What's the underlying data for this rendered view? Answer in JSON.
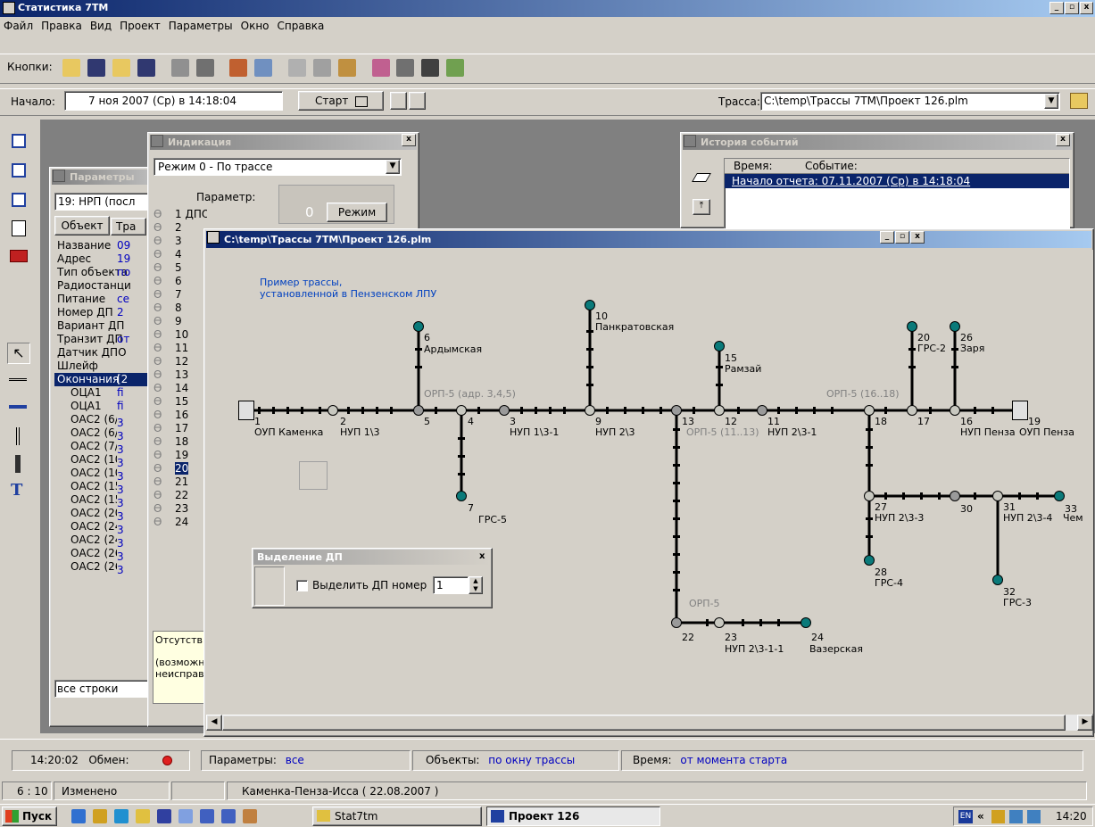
{
  "app": {
    "title": "Статистика 7ТМ"
  },
  "menu": [
    "Файл",
    "Правка",
    "Вид",
    "Проект",
    "Параметры",
    "Окно",
    "Справка"
  ],
  "toolbar": {
    "label": "Кнопки:"
  },
  "controls": {
    "start_label": "Начало:",
    "start_value": "7 ноя 2007 (Ср)  в  14:18:04",
    "start_button": "Старт",
    "trace_label": "Трасса:",
    "trace_value": "C:\\temp\\Трассы 7ТМ\\Проект 126.plm"
  },
  "params_window": {
    "title": "Параметры",
    "selector": "19: НРП    (посл",
    "tabs": [
      "Объект",
      "Тра"
    ],
    "rows": [
      {
        "name": "Название",
        "val": "09"
      },
      {
        "name": "Адрес",
        "val": "19"
      },
      {
        "name": "Тип объекта",
        "val": "по"
      },
      {
        "name": "Радиостанци",
        "val": ""
      },
      {
        "name": "Питание",
        "val": "се"
      },
      {
        "name": "Номер ДП",
        "val": "2"
      },
      {
        "name": "Вариант ДП",
        "val": ""
      },
      {
        "name": "Транзит ДП",
        "val": "от"
      },
      {
        "name": "Датчик ДПО",
        "val": ""
      },
      {
        "name": "Шлейф",
        "val": ""
      },
      {
        "name": "Окончания",
        "val": "[2"
      },
      {
        "name": "ОЦА1",
        "val": "fi"
      },
      {
        "name": "ОЦА1",
        "val": "fi"
      },
      {
        "name": "ОАС2 (6/3",
        "val": "3"
      },
      {
        "name": "ОАС2 (6/4",
        "val": "3"
      },
      {
        "name": "ОАС2 (7/3",
        "val": "3"
      },
      {
        "name": "ОАС2 (10/",
        "val": "3"
      },
      {
        "name": "ОАС2 (10/",
        "val": "3"
      },
      {
        "name": "ОАС2 (15/",
        "val": "3"
      },
      {
        "name": "ОАС2 (15/",
        "val": "3"
      },
      {
        "name": "ОАС2 (20/",
        "val": "3"
      },
      {
        "name": "ОАС2 (24/",
        "val": "3"
      },
      {
        "name": "ОАС2 (24/",
        "val": "3"
      },
      {
        "name": "ОАС2 (26/",
        "val": "3"
      },
      {
        "name": "ОАС2 (26/",
        "val": "3"
      }
    ],
    "footer": "все строки"
  },
  "indication_window": {
    "title": "Индикация",
    "mode": "Режим 0 -  По трассе",
    "param_header": "Параметр:",
    "first_param": "ДПО",
    "value": "0",
    "mode_button": "Режим",
    "numbers": [
      "1",
      "2",
      "3",
      "4",
      "5",
      "6",
      "7",
      "8",
      "9",
      "10",
      "11",
      "12",
      "13",
      "14",
      "15",
      "16",
      "17",
      "18",
      "19",
      "20",
      "21",
      "22",
      "23",
      "24"
    ],
    "bottom_text1": "Отсутств",
    "bottom_text2": "(возможн",
    "bottom_text3": "неисправ"
  },
  "history_window": {
    "title": "История событий",
    "col_time": "Время:",
    "col_event": "Событие:",
    "row1": "Начало отчета:  07.11.2007 (Ср)  в  14:18:04"
  },
  "trace_window": {
    "title": "C:\\temp\\Трассы 7ТМ\\Проект 126.plm",
    "note1": "Пример трассы,",
    "note2": "установленной в Пензенском ЛПУ",
    "labels": {
      "n1": "1",
      "oup_kamenka": "ОУП Каменка",
      "n2": "2",
      "nup1_3": "НУП 1\\3",
      "n5": "5",
      "n4": "4",
      "n3": "3",
      "nup1_3_1": "НУП 1\\3-1",
      "n6": "6",
      "ardym": "Ардымская",
      "orp5a": "ОРП-5 (адр. 3,4,5)",
      "n7": "7",
      "grs5": "ГРС-5",
      "n10": "10",
      "pankrat": "Панкратовская",
      "n9": "9",
      "nup2_3": "НУП 2\\3",
      "n13": "13",
      "orp5b": "ОРП-5 (11..13)",
      "nup2_3_1": "НУП 2\\3-1",
      "n15": "15",
      "ramzai": "Рамзай",
      "n12": "12",
      "n11": "11",
      "orp5c": "ОРП-5 (16..18)",
      "n20": "20",
      "grs2": "ГРС-2",
      "n26": "26",
      "zarya": "Заря",
      "n18": "18",
      "n17": "17",
      "n16": "16",
      "nup_penza": "НУП Пенза",
      "n19": "19",
      "oup_penza": "ОУП Пенза",
      "n27": "27",
      "nup2_3_3": "НУП 2\\3-3",
      "n30": "30",
      "n31": "31",
      "nup2_3_4": "НУП 2\\3-4",
      "n33": "33",
      "chem": "Чем",
      "n28": "28",
      "grs4": "ГРС-4",
      "n32": "32",
      "grs3": "ГРС-3",
      "orp5d": "ОРП-5",
      "n22": "22",
      "n23": "23",
      "nup2_3_1_1": "НУП 2\\3-1-1",
      "n24": "24",
      "vazer": "Вазерская"
    }
  },
  "select_dp": {
    "title": "Выделение ДП",
    "checkbox_label": "Выделить ДП номер",
    "value": "1"
  },
  "status": {
    "time": "14:20:02",
    "exchange": "Обмен:",
    "params_label": "Параметры:",
    "params_val": "все",
    "objects_label": "Объекты:",
    "objects_val": "по окну трассы",
    "time_label": "Время:",
    "time_val": "от момента старта"
  },
  "status2": {
    "pos": "6 : 10",
    "changed": "Изменено",
    "doc": "Каменка-Пенза-Исса  ( 22.08.2007 )"
  },
  "taskbar": {
    "start": "Пуск",
    "task1": "Stat7tm",
    "task2": "Проект 126",
    "lang": "EN",
    "clock": "14:20"
  }
}
